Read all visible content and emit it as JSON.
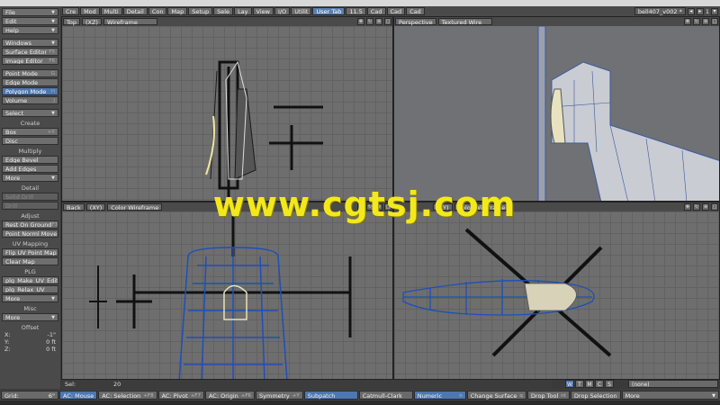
{
  "tabbar": {
    "tabs": [
      "Cre",
      "Mod",
      "Multi",
      "Detail",
      "Con",
      "Map",
      "Setup",
      "Sele",
      "Lay",
      "View",
      "I/O",
      "Utilit",
      "User Tab",
      "11.5",
      "Cad",
      "Cad",
      "Cad"
    ],
    "active_index": 12,
    "layer_dropdown": "bell407_v002 *",
    "layer_number": "1"
  },
  "toolbar": {
    "file": "File",
    "edit": "Edit",
    "help": "Help",
    "windows": "Windows",
    "surface_editor": "Surface Editor",
    "surface_editor_sc": "F5",
    "image_editor": "Image Editor",
    "image_editor_sc": "F6",
    "point_mode": "Point Mode",
    "point_mode_sc": "G",
    "edge_mode": "Edge Mode",
    "polygon_mode": "Polygon Mode",
    "polygon_mode_sc": "H",
    "volume": "Volume",
    "volume_sc": "J",
    "select": "Select",
    "create_head": "Create",
    "box": "Box",
    "box_sc": "+X",
    "disc": "Disc",
    "multiply_head": "Multiply",
    "edge_bevel": "Edge Bevel",
    "add_edges": "Add Edges",
    "more1": "More",
    "detail_head": "Detail",
    "solid_drill": "Solid Drill",
    "drill": "Drill",
    "adjust_head": "Adjust",
    "rest_on_ground": "Rest On Ground",
    "rest_on_ground_sc": "F3",
    "point_norml_move": "Point Norml Move",
    "uv_head": "UV Mapping",
    "flip_uv": "Flip UV Point Map",
    "clear_map": "Clear Map",
    "plg_head": "PLG",
    "plg_make_uv": "plg_Make_UV_Edit",
    "plg_relax_uv": "plg_Relax_UV",
    "more2": "More",
    "misc_head": "Misc",
    "more3": "More",
    "offset_head": "Offset",
    "x_label": "X:",
    "x_val": "-1\"",
    "y_label": "Y:",
    "y_val": "0 ft",
    "z_label": "Z:",
    "z_val": "0 ft"
  },
  "viewports": {
    "top": {
      "view": "Top",
      "axis": "(XZ)",
      "mode": "Wireframe"
    },
    "persp": {
      "view": "Perspective",
      "mode": "Textured Wire"
    },
    "back": {
      "view": "Back",
      "axis": "(XY)",
      "mode": "Color Wireframe"
    },
    "right": {
      "axis": "(ZY)",
      "mode": "Color Wireframe"
    }
  },
  "bottom": {
    "sel_label": "Sel:",
    "sel_value": "20",
    "grid_label": "Grid:",
    "grid_value": "6\"",
    "wtmcs": [
      "W",
      "T",
      "M",
      "C",
      "S"
    ],
    "none_value": "(none)"
  },
  "status": {
    "ac_mouse": "AC: Mouse",
    "ac_selection": "AC: Selection",
    "ac_selection_sc": "+F8",
    "ac_pivot": "AC: Pivot",
    "ac_pivot_sc": "+F7",
    "ac_origin": "AC: Origin",
    "ac_origin_sc": "+F6",
    "symmetry": "Symmetry",
    "symmetry_sc": "+Y",
    "subpatch": "Subpatch",
    "catmull": "Catmull-Clark",
    "numeric": "Numeric",
    "numeric_sc": "n",
    "change_surface": "Change Surface",
    "change_surface_sc": "q",
    "drop_tool": "Drop Tool",
    "drop_tool_sc": "nt",
    "drop_selection": "Drop Selection",
    "more": "More"
  },
  "watermark": "www.cgtsj.com",
  "colors": {
    "accent": "#4d77b0",
    "watermark": "#f3e81a",
    "wire_blue": "#1e4fb8"
  }
}
